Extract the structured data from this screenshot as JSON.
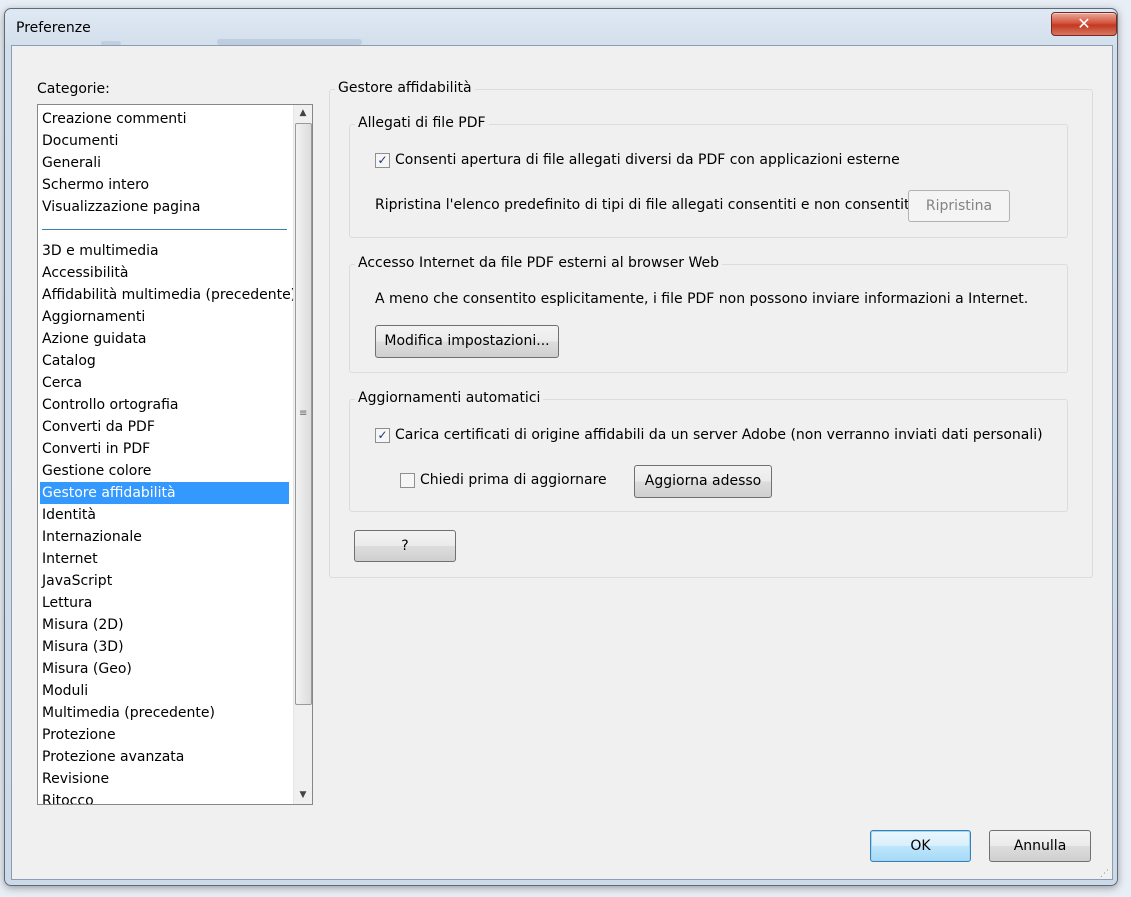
{
  "window": {
    "title": "Preferenze",
    "close_glyph": "✕"
  },
  "categories": {
    "label": "Categorie:",
    "group1": [
      "Creazione commenti",
      "Documenti",
      "Generali",
      "Schermo intero",
      "Visualizzazione pagina"
    ],
    "group2": [
      "3D e multimedia",
      "Accessibilità",
      "Affidabilità multimedia (precedente)",
      "Aggiornamenti",
      "Azione guidata",
      "Catalog",
      "Cerca",
      "Controllo ortografia",
      "Converti da PDF",
      "Converti in PDF",
      "Gestione colore",
      "Gestore affidabilità",
      "Identità",
      "Internazionale",
      "Internet",
      "JavaScript",
      "Lettura",
      "Misura (2D)",
      "Misura (3D)",
      "Misura (Geo)",
      "Moduli",
      "Multimedia (precedente)",
      "Protezione",
      "Protezione avanzata",
      "Revisione",
      "Ritocco"
    ],
    "selected": "Gestore affidabilità"
  },
  "panel": {
    "title": "Gestore affidabilità",
    "attachments": {
      "title": "Allegati di file PDF",
      "allow_checkbox_label": "Consenti apertura di file allegati diversi da PDF con applicazioni esterne",
      "allow_checked": true,
      "restore_text": "Ripristina l'elenco predefinito di tipi di file allegati consentiti e non consentiti:",
      "restore_button": "Ripristina"
    },
    "internet": {
      "title": "Accesso Internet da file PDF esterni al browser Web",
      "info_text": "A meno che consentito esplicitamente, i file PDF non possono inviare informazioni a Internet.",
      "change_button": "Modifica impostazioni..."
    },
    "updates": {
      "title": "Aggiornamenti automatici",
      "load_certs_label": "Carica certificati di origine affidabili da un server Adobe (non verranno inviati dati personali)",
      "load_certs_checked": true,
      "ask_label": "Chiedi prima di aggiornare",
      "ask_checked": false,
      "update_button": "Aggiorna adesso"
    },
    "help_button": "?"
  },
  "footer": {
    "ok": "OK",
    "cancel": "Annulla"
  }
}
